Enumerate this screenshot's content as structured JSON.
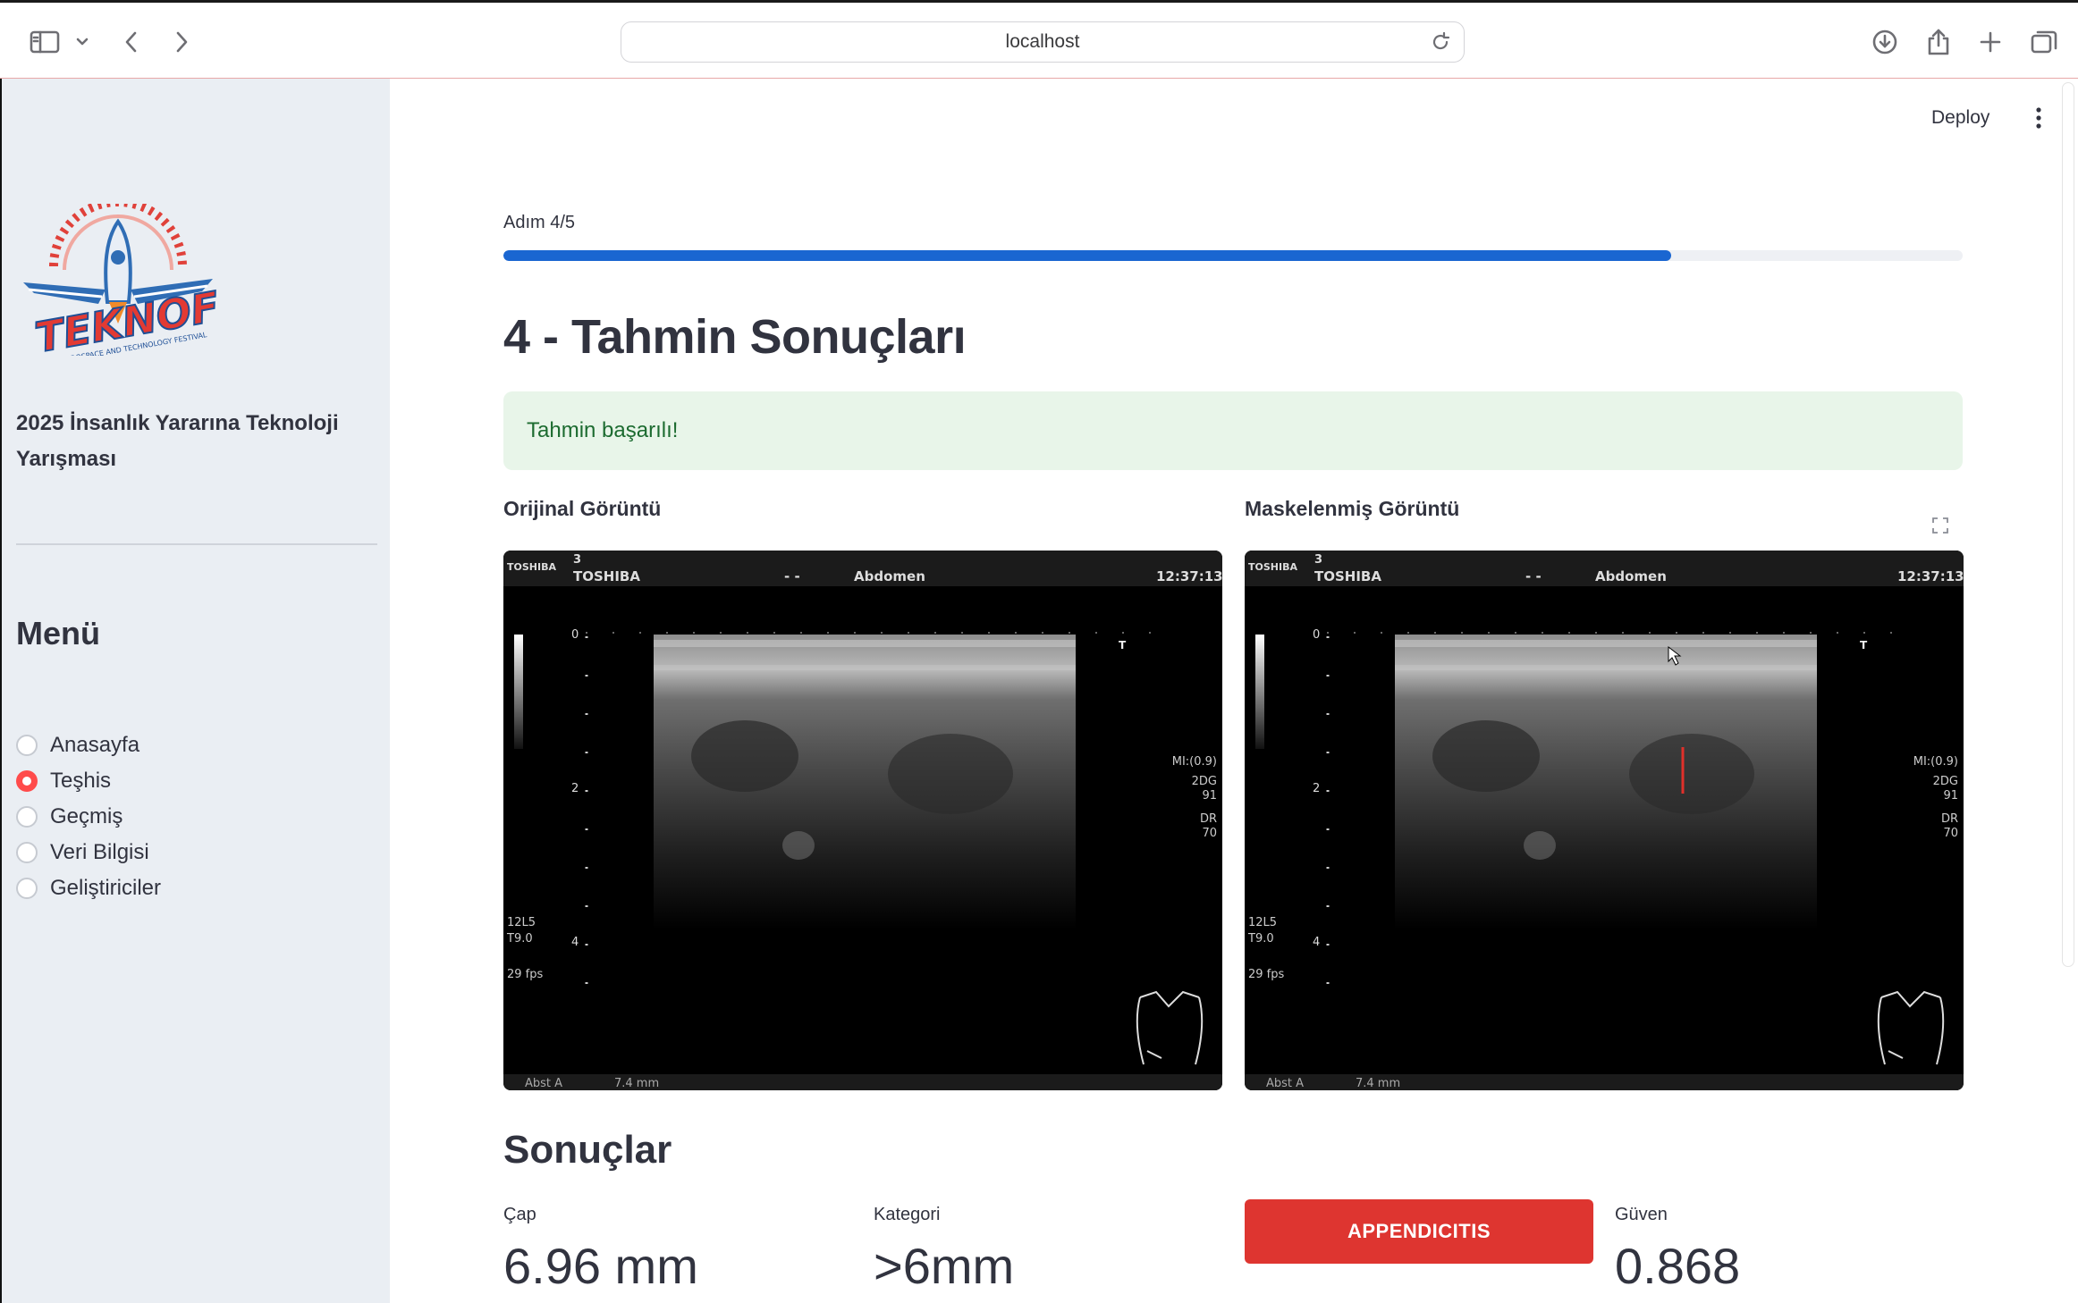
{
  "browser": {
    "url": "localhost"
  },
  "header": {
    "deploy_label": "Deploy"
  },
  "sidebar": {
    "logo_text": "TEKNOFEST",
    "logo_subtitle": "AEROSPACE AND TECHNOLOGY FESTIVAL",
    "title": "2025 İnsanlık Yararına Teknoloji Yarışması",
    "menu_heading": "Menü",
    "items": [
      {
        "label": "Anasayfa",
        "selected": false
      },
      {
        "label": "Teşhis",
        "selected": true
      },
      {
        "label": "Geçmiş",
        "selected": false
      },
      {
        "label": "Veri Bilgisi",
        "selected": false
      },
      {
        "label": "Geliştiriciler",
        "selected": false
      }
    ]
  },
  "main": {
    "step_label": "Adım 4/5",
    "progress": 0.8,
    "page_title": "4 - Tahmin Sonuçları",
    "success_message": "Tahmin başarılı!",
    "images": [
      {
        "caption": "Orijinal Görüntü"
      },
      {
        "caption": "Maskelenmiş Görüntü"
      }
    ],
    "ultrasound": {
      "brand_small": "TOSHIBA",
      "probe_num": "3",
      "brand": "TOSHIBA",
      "dashes": "- -",
      "region": "Abdomen",
      "time": "12:37:13",
      "depth_0": "0",
      "depth_2": "2",
      "depth_4": "4",
      "mi": "MI:(0.9)",
      "mode": "2DG",
      "gain": "91",
      "dr_label": "DR",
      "dr_value": "70",
      "freq": "12L5",
      "t_value": "T9.0",
      "fps": "29 fps",
      "footer_label": "Abst A",
      "footer_value": "7.4 mm",
      "t_marker": "T"
    },
    "results_heading": "Sonuçlar",
    "metrics": {
      "diameter_label": "Çap",
      "diameter_value": "6.96 mm",
      "category_label": "Kategori",
      "category_value": ">6mm",
      "diagnosis": "APPENDICITIS",
      "confidence_label": "Güven",
      "confidence_value": "0.868"
    }
  },
  "colors": {
    "accent_red": "#ff4b4b",
    "progress_blue": "#1a66d1",
    "diagnosis_red": "#de3530",
    "success_bg": "#e8f5e9",
    "success_text": "#1c6b30",
    "sidebar_bg": "#eaeef3"
  }
}
